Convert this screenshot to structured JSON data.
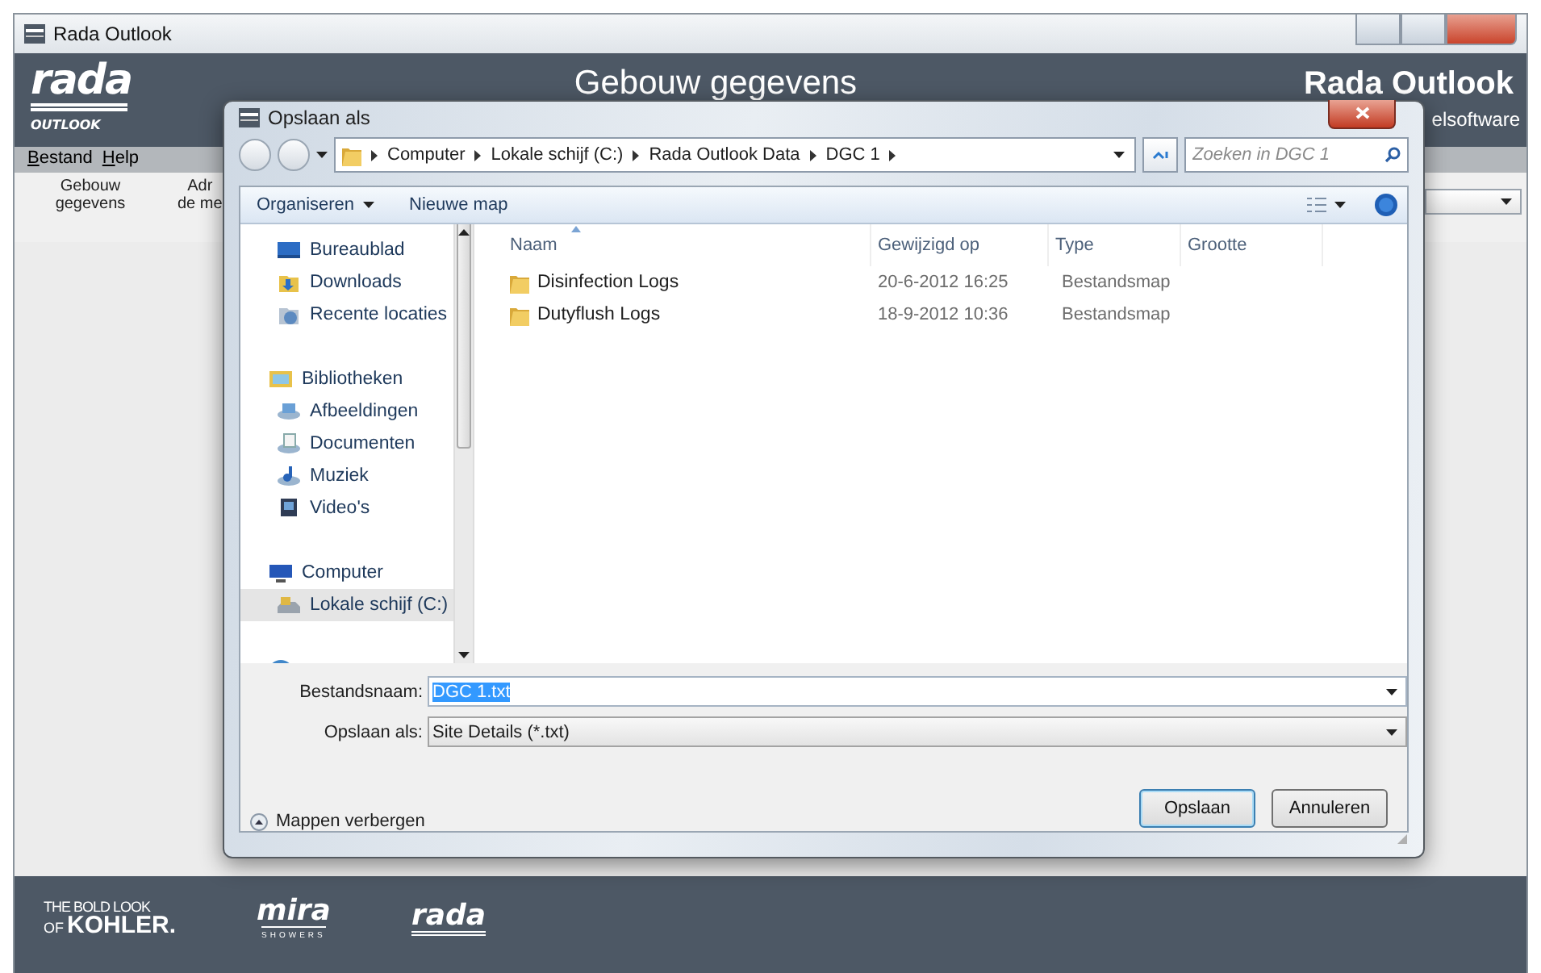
{
  "window": {
    "title": "Rada Outlook"
  },
  "header": {
    "logo": {
      "wordmark": "rada",
      "subtitle": "OUTLOOK"
    },
    "title": "Gebouw gegevens",
    "brand": "Rada Outlook",
    "tagline": "elsoftware"
  },
  "menu": [
    "Bestand",
    "Help"
  ],
  "toolbar": [
    {
      "lines": [
        "Gebouw",
        "gegevens"
      ]
    },
    {
      "lines": [
        "Adr",
        "de me"
      ]
    }
  ],
  "footer": [
    {
      "kind": "kohler",
      "top": "THE BOLD LOOK",
      "small": "OF",
      "main": "KOHLER."
    },
    {
      "kind": "mira",
      "main": "mira",
      "sub": "SHOWERS"
    },
    {
      "kind": "rada",
      "main": "rada"
    }
  ],
  "dialog": {
    "title": "Opslaan als",
    "breadcrumb": [
      "Computer",
      "Lokale schijf (C:)",
      "Rada Outlook Data",
      "DGC 1"
    ],
    "search": {
      "placeholder": "Zoeken in DGC 1"
    },
    "commands": [
      {
        "label": "Organiseren",
        "menu": true
      },
      {
        "label": "Nieuwe map",
        "menu": false
      }
    ],
    "nav": [
      {
        "children": [
          {
            "kind": "desktop",
            "label": "Bureaublad",
            "selected": false
          },
          {
            "kind": "downloads",
            "label": "Downloads",
            "selected": false
          },
          {
            "kind": "recent",
            "label": "Recente locaties",
            "selected": false
          }
        ]
      },
      {
        "kind": "library",
        "label": "Bibliotheken",
        "selected": false,
        "children": [
          {
            "kind": "pictures",
            "label": "Afbeeldingen",
            "selected": false
          },
          {
            "kind": "documents",
            "label": "Documenten",
            "selected": false
          },
          {
            "kind": "music",
            "label": "Muziek",
            "selected": false
          },
          {
            "kind": "videos",
            "label": "Video's",
            "selected": false
          }
        ]
      },
      {
        "kind": "computer",
        "label": "Computer",
        "selected": false,
        "children": [
          {
            "kind": "drive",
            "label": "Lokale schijf (C:)",
            "selected": true
          }
        ]
      },
      {
        "kind": "network",
        "selected": false
      }
    ],
    "columns": [
      "Naam",
      "Gewijzigd op",
      "Type",
      "Grootte"
    ],
    "rows": [
      {
        "name": "Disinfection Logs",
        "modified": "20-6-2012 16:25",
        "type": "Bestandsmap"
      },
      {
        "name": "Dutyflush Logs",
        "modified": "18-9-2012 10:36",
        "type": "Bestandsmap"
      }
    ],
    "filename": {
      "label": "Bestandsnaam:",
      "value": "DGC 1.txt",
      "selected": true
    },
    "savetype": {
      "label": "Opslaan als:",
      "value": "Site Details (*.txt)"
    },
    "hide_folders": "Mappen verbergen",
    "buttons": [
      {
        "label": "Opslaan",
        "default": true
      },
      {
        "label": "Annuleren",
        "default": false
      }
    ]
  }
}
